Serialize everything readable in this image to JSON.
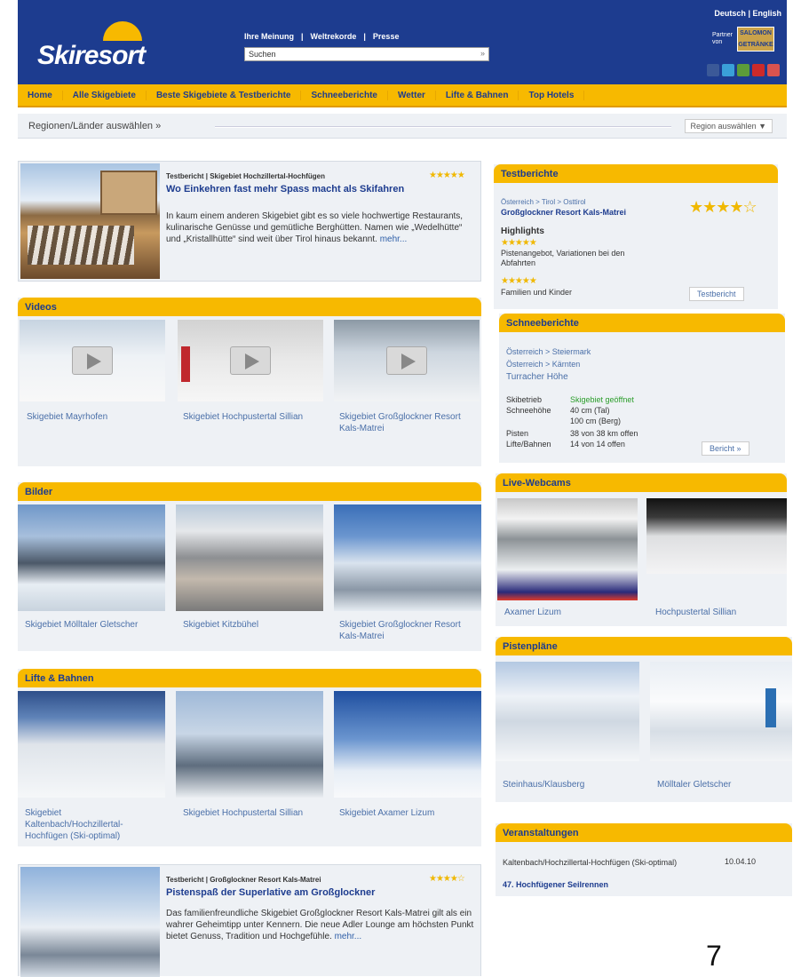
{
  "header": {
    "logo": "Skiresort",
    "top_links": [
      "Ihre Meinung",
      "|",
      "Weltrekorde",
      "|",
      "Presse"
    ],
    "search_value": "Suchen",
    "search_go": "»",
    "lang": [
      "Deutsch",
      "|",
      "English"
    ],
    "partner_label": "Partner von",
    "partner_box": "SALOMON GETRÄNKE"
  },
  "nav": [
    "Home",
    "Alle Skigebiete",
    "Beste Skigebiete & Testberichte",
    "Schneeberichte",
    "Wetter",
    "Lifte & Bahnen",
    "Top Hotels"
  ],
  "region": {
    "label": "Regionen/Länder auswählen »",
    "select": "Region auswählen ▼"
  },
  "feature1": {
    "meta": "Testbericht | Skigebiet Hochzillertal-Hochfügen",
    "stars": "★★★★★",
    "title": "Wo Einkehren fast mehr Spass macht als Skifahren",
    "body": "In kaum einem anderen Skigebiet gibt es so viele hochwertige Restaurants, kulinarische Genüsse und gemütliche Berghütten. Namen wie „Wedelhütte“ und „Kristallhütte“ sind weit über Tirol hinaus bekannt.",
    "more": "mehr..."
  },
  "videos": {
    "title": "Videos",
    "items": [
      "Skigebiet Mayrhofen",
      "Skigebiet Hochpustertal Sillian",
      "Skigebiet Großglockner Resort Kals-Matrei"
    ]
  },
  "bilder": {
    "title": "Bilder",
    "items": [
      "Skigebiet Mölltaler Gletscher",
      "Skigebiet Kitzbühel",
      "Skigebiet Großglockner Resort Kals-Matrei"
    ]
  },
  "lifte": {
    "title": "Lifte & Bahnen",
    "items": [
      "Skigebiet Kaltenbach/Hochzillertal-Hochfügen (Ski-optimal)",
      "Skigebiet Hochpustertal Sillian",
      "Skigebiet Axamer Lizum"
    ]
  },
  "feature2": {
    "meta": "Testbericht | Großglockner Resort Kals-Matrei",
    "stars": "★★★★☆",
    "title": "Pistenspaß der Superlative am Großglockner",
    "body": "Das familienfreundliche Skigebiet Großglockner Resort Kals-Matrei gilt als ein wahrer Geheimtipp unter Kennern. Die neue Adler Lounge am höchsten Punkt bietet Genuss, Tradition und Hochgefühle.",
    "more": "mehr..."
  },
  "testberichte": {
    "title": "Testberichte",
    "path": "Österreich > Tirol > Osttirol",
    "resort": "Großglockner Resort Kals-Matrei",
    "stars": "★★★★☆",
    "highlights": "Highlights",
    "h1_stars": "★★★★★",
    "h1": "Pistenangebot, Variationen bei den Abfahrten",
    "h2_stars": "★★★★★",
    "h2": "Familien und Kinder",
    "button": "Testbericht"
  },
  "schnee": {
    "title": "Schneeberichte",
    "l1": "Österreich > Steiermark",
    "l2": "Österreich > Kärnten",
    "place": "Turracher Höhe",
    "rows": [
      [
        "Skibetrieb",
        "Skigebiet geöffnet"
      ],
      [
        "Schneehöhe",
        "40 cm (Tal)"
      ],
      [
        "",
        "100 cm (Berg)"
      ],
      [
        "Pisten",
        "38 von 38 km offen"
      ],
      [
        "Lifte/Bahnen",
        "14 von 14 offen"
      ]
    ],
    "button": "Bericht »"
  },
  "webcams": {
    "title": "Live-Webcams",
    "items": [
      "Axamer Lizum",
      "Hochpustertal Sillian"
    ]
  },
  "pisten": {
    "title": "Pistenpläne",
    "items": [
      "Steinhaus/Klausberg",
      "Mölltaler Gletscher"
    ]
  },
  "events": {
    "title": "Veranstaltungen",
    "place": "Kaltenbach/Hochzillertal-Hochfügen (Ski-optimal)",
    "date": "10.04.10",
    "event": "47. Hochfügener Seilrennen"
  },
  "page_number": "7",
  "colors": {
    "navy": "#1d3c8f",
    "gold": "#f7b900",
    "panel": "#eef1f5",
    "link": "#2f5fa8"
  }
}
